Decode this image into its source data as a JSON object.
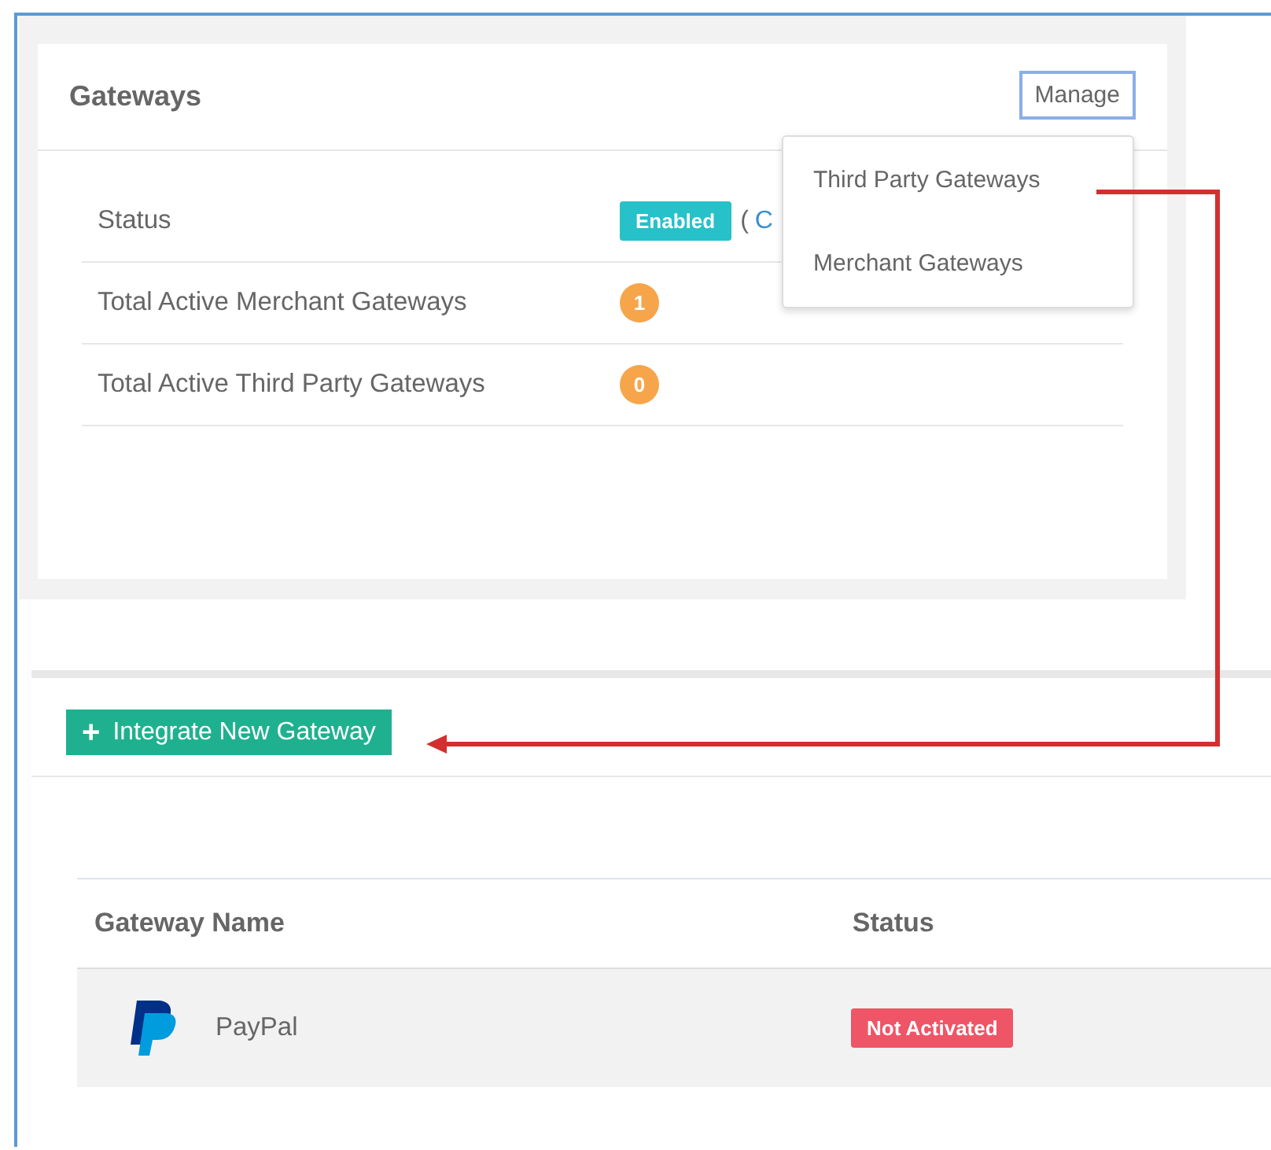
{
  "panel": {
    "title": "Gateways",
    "manage_button": "Manage",
    "menu": [
      {
        "label": "Third Party Gateways"
      },
      {
        "label": "Merchant Gateways"
      }
    ],
    "rows": [
      {
        "kind": "status",
        "label": "Status",
        "badge": "Enabled",
        "paren": "(",
        "link": "C"
      },
      {
        "kind": "count",
        "label": "Total Active Merchant Gateways",
        "count": "1"
      },
      {
        "kind": "count",
        "label": "Total Active Third Party Gateways",
        "count": "0"
      }
    ]
  },
  "integrate_button": {
    "icon": "+",
    "label": "Integrate New Gateway"
  },
  "table": {
    "columns": [
      "Gateway Name",
      "Status"
    ],
    "rows": [
      {
        "name": "PayPal",
        "status": "Not Activated"
      }
    ]
  }
}
